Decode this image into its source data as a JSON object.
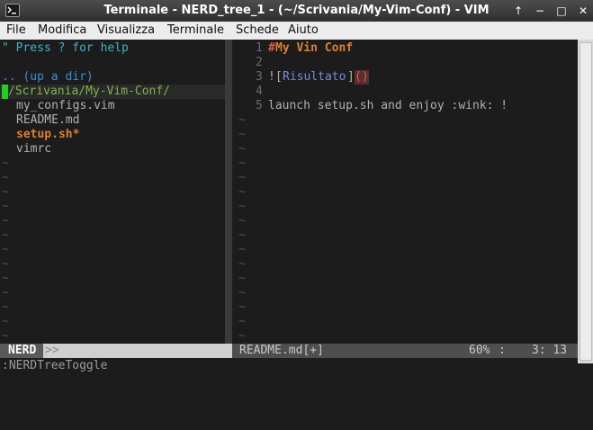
{
  "window": {
    "title": "Terminale - NERD_tree_1 - (~/Scrivania/My-Vim-Conf) - VIM"
  },
  "titlebar_buttons": [
    "↑",
    "−",
    "□",
    "✕"
  ],
  "menu": {
    "items": [
      "File",
      "Modifica",
      "Visualizza",
      "Terminale",
      "Schede",
      "Aiuto"
    ]
  },
  "nerdtree": {
    "help": "\" Press ? for help",
    "up_dir": ".. (up a dir)",
    "root": "/Scrivania/My-Vim-Conf/",
    "files": [
      "my_configs.vim",
      "README.md",
      "setup.sh*",
      "vimrc"
    ],
    "tilde": "~"
  },
  "editor": {
    "line_numbers": [
      "1",
      "2",
      "3",
      "4",
      "5"
    ],
    "lines": {
      "l1_hash": "#",
      "l1_text": "My Vin Conf",
      "l3_bang": "!",
      "l3_lb": "[",
      "l3_text": "Risultato",
      "l3_rb": "]",
      "l3_parens": "()",
      "l5_text": "launch setup.sh and enjoy :wink: !"
    },
    "tilde": "~"
  },
  "statusline": {
    "left_label": "NERD",
    "left_arrow": ">>",
    "right_file": "README.md[+]",
    "right_percent": "60%",
    "right_colon": ":",
    "right_pos": "3: 13"
  },
  "command_line": ":NERDTreeToggle",
  "colors": {
    "background": "#1c1c1c",
    "cyan": "#3fb0c6",
    "blue": "#3d8ed8",
    "green_dir": "#7eb54c",
    "orange": "#e07f2b",
    "gray": "#b0b0b0",
    "line_number": "#6a6a6a",
    "link": "#7b88d6",
    "red": "#e0584c"
  }
}
